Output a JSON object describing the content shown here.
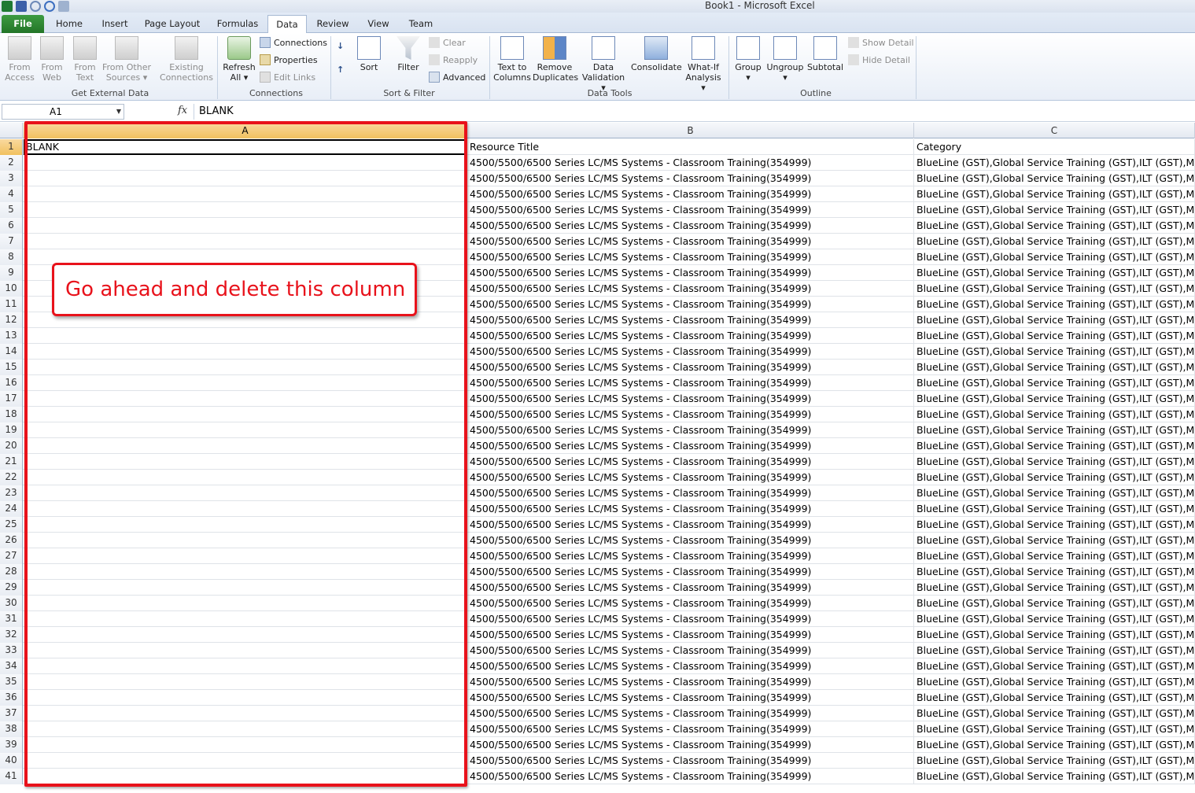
{
  "window": {
    "title": "Book1  -  Microsoft Excel"
  },
  "tabs": [
    {
      "label": "File"
    },
    {
      "label": "Home"
    },
    {
      "label": "Insert"
    },
    {
      "label": "Page Layout"
    },
    {
      "label": "Formulas"
    },
    {
      "label": "Data"
    },
    {
      "label": "Review"
    },
    {
      "label": "View"
    },
    {
      "label": "Team"
    }
  ],
  "ribbon": {
    "get_external_data": {
      "label": "Get External Data",
      "from_access": [
        "From",
        "Access"
      ],
      "from_web": [
        "From",
        "Web"
      ],
      "from_text": [
        "From",
        "Text"
      ],
      "from_other": [
        "From Other",
        "Sources ▾"
      ],
      "existing": [
        "Existing",
        "Connections"
      ]
    },
    "connections": {
      "label": "Connections",
      "refresh": [
        "Refresh",
        "All ▾"
      ],
      "connections": "Connections",
      "properties": "Properties",
      "edit_links": "Edit Links"
    },
    "sort_filter": {
      "label": "Sort & Filter",
      "sort": "Sort",
      "filter": "Filter",
      "clear": "Clear",
      "reapply": "Reapply",
      "advanced": "Advanced"
    },
    "data_tools": {
      "label": "Data Tools",
      "text_to_columns": [
        "Text to",
        "Columns"
      ],
      "remove_duplicates": [
        "Remove",
        "Duplicates"
      ],
      "data_validation": [
        "Data",
        "Validation ▾"
      ],
      "consolidate": "Consolidate",
      "what_if": [
        "What-If",
        "Analysis ▾"
      ]
    },
    "outline": {
      "label": "Outline",
      "group": [
        "Group",
        "▾"
      ],
      "ungroup": [
        "Ungroup",
        "▾"
      ],
      "subtotal": "Subtotal",
      "show_detail": "Show Detail",
      "hide_detail": "Hide Detail"
    }
  },
  "formula_bar": {
    "name_box": "A1",
    "fx": "fx",
    "value": "BLANK"
  },
  "columns": [
    {
      "label": "A"
    },
    {
      "label": "B"
    },
    {
      "label": "C"
    }
  ],
  "rows": [
    {
      "n": "1",
      "a": "BLANK",
      "b": "Resource Title",
      "c": "Category"
    },
    {
      "n": "2",
      "a": "",
      "b": "4500/5500/6500 Series LC/MS Systems - Classroom Training(354999)",
      "c": "BlueLine (GST),Global Service Training (GST),ILT (GST),Mas"
    },
    {
      "n": "3",
      "a": "",
      "b": "4500/5500/6500 Series LC/MS Systems - Classroom Training(354999)",
      "c": "BlueLine (GST),Global Service Training (GST),ILT (GST),Mas"
    },
    {
      "n": "4",
      "a": "",
      "b": "4500/5500/6500 Series LC/MS Systems - Classroom Training(354999)",
      "c": "BlueLine (GST),Global Service Training (GST),ILT (GST),Mas"
    },
    {
      "n": "5",
      "a": "",
      "b": "4500/5500/6500 Series LC/MS Systems - Classroom Training(354999)",
      "c": "BlueLine (GST),Global Service Training (GST),ILT (GST),Mas"
    },
    {
      "n": "6",
      "a": "",
      "b": "4500/5500/6500 Series LC/MS Systems - Classroom Training(354999)",
      "c": "BlueLine (GST),Global Service Training (GST),ILT (GST),Mas"
    },
    {
      "n": "7",
      "a": "",
      "b": "4500/5500/6500 Series LC/MS Systems - Classroom Training(354999)",
      "c": "BlueLine (GST),Global Service Training (GST),ILT (GST),Mas"
    },
    {
      "n": "8",
      "a": "",
      "b": "4500/5500/6500 Series LC/MS Systems - Classroom Training(354999)",
      "c": "BlueLine (GST),Global Service Training (GST),ILT (GST),Mas"
    },
    {
      "n": "9",
      "a": "",
      "b": "4500/5500/6500 Series LC/MS Systems - Classroom Training(354999)",
      "c": "BlueLine (GST),Global Service Training (GST),ILT (GST),Mas"
    },
    {
      "n": "10",
      "a": "",
      "b": "4500/5500/6500 Series LC/MS Systems - Classroom Training(354999)",
      "c": "BlueLine (GST),Global Service Training (GST),ILT (GST),Mas"
    },
    {
      "n": "11",
      "a": "",
      "b": "4500/5500/6500 Series LC/MS Systems - Classroom Training(354999)",
      "c": "BlueLine (GST),Global Service Training (GST),ILT (GST),Mas"
    },
    {
      "n": "12",
      "a": "",
      "b": "4500/5500/6500 Series LC/MS Systems - Classroom Training(354999)",
      "c": "BlueLine (GST),Global Service Training (GST),ILT (GST),Mas"
    },
    {
      "n": "13",
      "a": "",
      "b": "4500/5500/6500 Series LC/MS Systems - Classroom Training(354999)",
      "c": "BlueLine (GST),Global Service Training (GST),ILT (GST),Mas"
    },
    {
      "n": "14",
      "a": "",
      "b": "4500/5500/6500 Series LC/MS Systems - Classroom Training(354999)",
      "c": "BlueLine (GST),Global Service Training (GST),ILT (GST),Mas"
    },
    {
      "n": "15",
      "a": "",
      "b": "4500/5500/6500 Series LC/MS Systems - Classroom Training(354999)",
      "c": "BlueLine (GST),Global Service Training (GST),ILT (GST),Mas"
    },
    {
      "n": "16",
      "a": "",
      "b": "4500/5500/6500 Series LC/MS Systems - Classroom Training(354999)",
      "c": "BlueLine (GST),Global Service Training (GST),ILT (GST),Mas"
    },
    {
      "n": "17",
      "a": "",
      "b": "4500/5500/6500 Series LC/MS Systems - Classroom Training(354999)",
      "c": "BlueLine (GST),Global Service Training (GST),ILT (GST),Mas"
    },
    {
      "n": "18",
      "a": "",
      "b": "4500/5500/6500 Series LC/MS Systems - Classroom Training(354999)",
      "c": "BlueLine (GST),Global Service Training (GST),ILT (GST),Mas"
    },
    {
      "n": "19",
      "a": "",
      "b": "4500/5500/6500 Series LC/MS Systems - Classroom Training(354999)",
      "c": "BlueLine (GST),Global Service Training (GST),ILT (GST),Mas"
    },
    {
      "n": "20",
      "a": "",
      "b": "4500/5500/6500 Series LC/MS Systems - Classroom Training(354999)",
      "c": "BlueLine (GST),Global Service Training (GST),ILT (GST),Mas"
    },
    {
      "n": "21",
      "a": "",
      "b": "4500/5500/6500 Series LC/MS Systems - Classroom Training(354999)",
      "c": "BlueLine (GST),Global Service Training (GST),ILT (GST),Mas"
    },
    {
      "n": "22",
      "a": "",
      "b": "4500/5500/6500 Series LC/MS Systems - Classroom Training(354999)",
      "c": "BlueLine (GST),Global Service Training (GST),ILT (GST),Mas"
    },
    {
      "n": "23",
      "a": "",
      "b": "4500/5500/6500 Series LC/MS Systems - Classroom Training(354999)",
      "c": "BlueLine (GST),Global Service Training (GST),ILT (GST),Mas"
    },
    {
      "n": "24",
      "a": "",
      "b": "4500/5500/6500 Series LC/MS Systems - Classroom Training(354999)",
      "c": "BlueLine (GST),Global Service Training (GST),ILT (GST),Mas"
    },
    {
      "n": "25",
      "a": "",
      "b": "4500/5500/6500 Series LC/MS Systems - Classroom Training(354999)",
      "c": "BlueLine (GST),Global Service Training (GST),ILT (GST),Mas"
    },
    {
      "n": "26",
      "a": "",
      "b": "4500/5500/6500 Series LC/MS Systems - Classroom Training(354999)",
      "c": "BlueLine (GST),Global Service Training (GST),ILT (GST),Mas"
    },
    {
      "n": "27",
      "a": "",
      "b": "4500/5500/6500 Series LC/MS Systems - Classroom Training(354999)",
      "c": "BlueLine (GST),Global Service Training (GST),ILT (GST),Mas"
    },
    {
      "n": "28",
      "a": "",
      "b": "4500/5500/6500 Series LC/MS Systems - Classroom Training(354999)",
      "c": "BlueLine (GST),Global Service Training (GST),ILT (GST),Mas"
    },
    {
      "n": "29",
      "a": "",
      "b": "4500/5500/6500 Series LC/MS Systems - Classroom Training(354999)",
      "c": "BlueLine (GST),Global Service Training (GST),ILT (GST),Mas"
    },
    {
      "n": "30",
      "a": "",
      "b": "4500/5500/6500 Series LC/MS Systems - Classroom Training(354999)",
      "c": "BlueLine (GST),Global Service Training (GST),ILT (GST),Mas"
    },
    {
      "n": "31",
      "a": "",
      "b": "4500/5500/6500 Series LC/MS Systems - Classroom Training(354999)",
      "c": "BlueLine (GST),Global Service Training (GST),ILT (GST),Mas"
    },
    {
      "n": "32",
      "a": "",
      "b": "4500/5500/6500 Series LC/MS Systems - Classroom Training(354999)",
      "c": "BlueLine (GST),Global Service Training (GST),ILT (GST),Mas"
    },
    {
      "n": "33",
      "a": "",
      "b": "4500/5500/6500 Series LC/MS Systems - Classroom Training(354999)",
      "c": "BlueLine (GST),Global Service Training (GST),ILT (GST),Mas"
    },
    {
      "n": "34",
      "a": "",
      "b": "4500/5500/6500 Series LC/MS Systems - Classroom Training(354999)",
      "c": "BlueLine (GST),Global Service Training (GST),ILT (GST),Mas"
    },
    {
      "n": "35",
      "a": "",
      "b": "4500/5500/6500 Series LC/MS Systems - Classroom Training(354999)",
      "c": "BlueLine (GST),Global Service Training (GST),ILT (GST),Mas"
    },
    {
      "n": "36",
      "a": "",
      "b": "4500/5500/6500 Series LC/MS Systems - Classroom Training(354999)",
      "c": "BlueLine (GST),Global Service Training (GST),ILT (GST),Mas"
    },
    {
      "n": "37",
      "a": "",
      "b": "4500/5500/6500 Series LC/MS Systems - Classroom Training(354999)",
      "c": "BlueLine (GST),Global Service Training (GST),ILT (GST),Mas"
    },
    {
      "n": "38",
      "a": "",
      "b": "4500/5500/6500 Series LC/MS Systems - Classroom Training(354999)",
      "c": "BlueLine (GST),Global Service Training (GST),ILT (GST),Mas"
    },
    {
      "n": "39",
      "a": "",
      "b": "4500/5500/6500 Series LC/MS Systems - Classroom Training(354999)",
      "c": "BlueLine (GST),Global Service Training (GST),ILT (GST),Mas"
    },
    {
      "n": "40",
      "a": "",
      "b": "4500/5500/6500 Series LC/MS Systems - Classroom Training(354999)",
      "c": "BlueLine (GST),Global Service Training (GST),ILT (GST),Mas"
    },
    {
      "n": "41",
      "a": "",
      "b": "4500/5500/6500 Series LC/MS Systems - Classroom Training(354999)",
      "c": "BlueLine (GST),Global Service Training (GST),ILT (GST),Mas"
    }
  ],
  "annotation": {
    "text": "Go ahead and delete this column",
    "color": "#e8121b"
  },
  "colors": {
    "file_tab": "#2e8b33",
    "selection_header": "#f1c15f"
  }
}
